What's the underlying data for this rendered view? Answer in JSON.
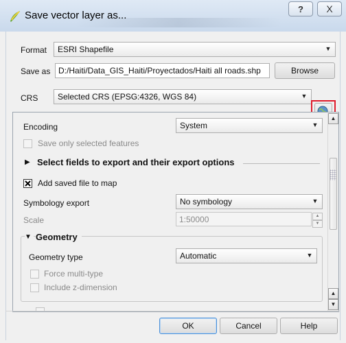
{
  "window": {
    "title": "Save vector layer as...",
    "help_glyph": "?",
    "close_glyph": "X"
  },
  "format": {
    "label": "Format",
    "value": "ESRI Shapefile"
  },
  "save_as": {
    "label": "Save as",
    "path": "D:/Haiti/Data_GIS_Haiti/Proyectados/Haiti all roads.shp",
    "browse_label": "Browse"
  },
  "crs": {
    "label": "CRS",
    "value": "Selected CRS (EPSG:4326, WGS 84)",
    "selector_icon": "globe-crs-icon"
  },
  "options": {
    "encoding_label": "Encoding",
    "encoding_value": "System",
    "save_only_selected_label": "Save only selected features",
    "save_only_selected_checked": false,
    "select_fields_label": "Select fields to export and their export options",
    "add_saved_label": "Add saved file to map",
    "add_saved_checked": true,
    "symbology_label": "Symbology export",
    "symbology_value": "No symbology",
    "scale_label": "Scale",
    "scale_value": "1:50000",
    "geometry_section": "Geometry",
    "geometry_type_label": "Geometry type",
    "geometry_type_value": "Automatic",
    "force_multi_label": "Force multi-type",
    "include_z_label": "Include z-dimension"
  },
  "buttons": {
    "ok": "OK",
    "cancel": "Cancel",
    "help": "Help"
  },
  "colors": {
    "highlight": "#e01a2a",
    "titlebar": "#c9d9ec"
  }
}
